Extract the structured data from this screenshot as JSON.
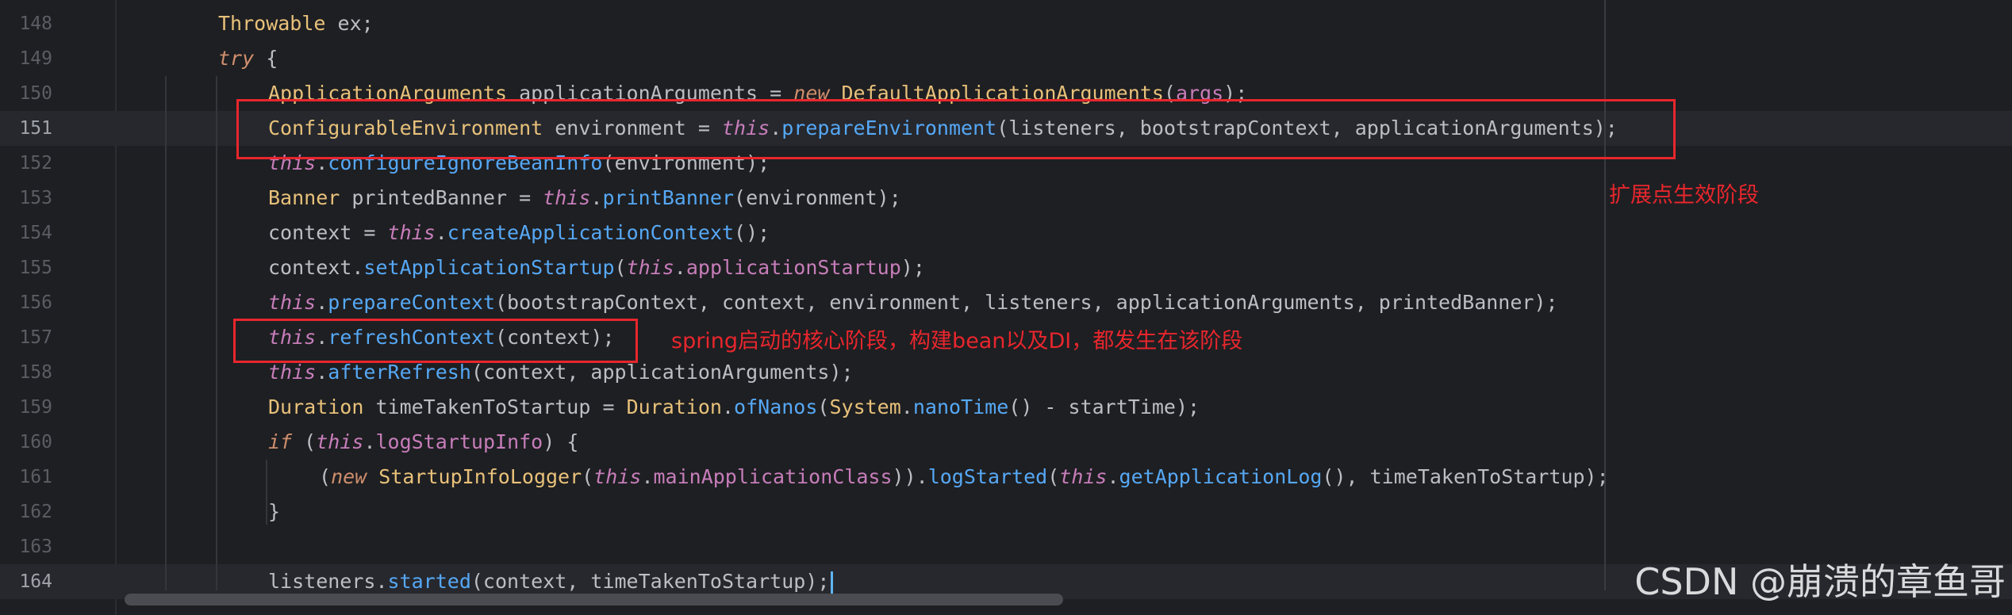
{
  "editor": {
    "lines": [
      {
        "no": "148",
        "tokens": [
          {
            "t": "Throwable",
            "c": "ty"
          },
          {
            "t": " ex;",
            "c": ""
          }
        ]
      },
      {
        "no": "149",
        "tokens": [
          {
            "t": "try",
            "c": "kw"
          },
          {
            "t": " {",
            "c": ""
          }
        ]
      },
      {
        "no": "150",
        "tokens": [
          {
            "t": "ApplicationArguments",
            "c": "ty"
          },
          {
            "t": " applicationArguments = ",
            "c": ""
          },
          {
            "t": "new",
            "c": "kw"
          },
          {
            "t": " ",
            "c": ""
          },
          {
            "t": "DefaultApplicationArguments",
            "c": "ty"
          },
          {
            "t": "(",
            "c": ""
          },
          {
            "t": "args",
            "c": "fd"
          },
          {
            "t": ");",
            "c": ""
          }
        ]
      },
      {
        "no": "151",
        "tokens": [
          {
            "t": "ConfigurableEnvironment",
            "c": "ty"
          },
          {
            "t": " environment = ",
            "c": ""
          },
          {
            "t": "this",
            "c": "th"
          },
          {
            "t": ".",
            "c": ""
          },
          {
            "t": "prepareEnvironment",
            "c": "fn"
          },
          {
            "t": "(listeners, bootstrapContext, applicationArguments);",
            "c": ""
          }
        ]
      },
      {
        "no": "152",
        "tokens": [
          {
            "t": "this",
            "c": "th"
          },
          {
            "t": ".",
            "c": ""
          },
          {
            "t": "configureIgnoreBeanInfo",
            "c": "fn"
          },
          {
            "t": "(environment);",
            "c": ""
          }
        ]
      },
      {
        "no": "153",
        "tokens": [
          {
            "t": "Banner",
            "c": "ty"
          },
          {
            "t": " printedBanner = ",
            "c": ""
          },
          {
            "t": "this",
            "c": "th"
          },
          {
            "t": ".",
            "c": ""
          },
          {
            "t": "printBanner",
            "c": "fn"
          },
          {
            "t": "(environment);",
            "c": ""
          }
        ]
      },
      {
        "no": "154",
        "tokens": [
          {
            "t": "context = ",
            "c": ""
          },
          {
            "t": "this",
            "c": "th"
          },
          {
            "t": ".",
            "c": ""
          },
          {
            "t": "createApplicationContext",
            "c": "fn"
          },
          {
            "t": "();",
            "c": ""
          }
        ]
      },
      {
        "no": "155",
        "tokens": [
          {
            "t": "context.",
            "c": ""
          },
          {
            "t": "setApplicationStartup",
            "c": "fn"
          },
          {
            "t": "(",
            "c": ""
          },
          {
            "t": "this",
            "c": "th"
          },
          {
            "t": ".",
            "c": ""
          },
          {
            "t": "applicationStartup",
            "c": "fd"
          },
          {
            "t": ");",
            "c": ""
          }
        ]
      },
      {
        "no": "156",
        "tokens": [
          {
            "t": "this",
            "c": "th"
          },
          {
            "t": ".",
            "c": ""
          },
          {
            "t": "prepareContext",
            "c": "fn"
          },
          {
            "t": "(bootstrapContext, context, environment, listeners, applicationArguments, printedBanner);",
            "c": ""
          }
        ]
      },
      {
        "no": "157",
        "tokens": [
          {
            "t": "this",
            "c": "th"
          },
          {
            "t": ".",
            "c": ""
          },
          {
            "t": "refreshContext",
            "c": "fn"
          },
          {
            "t": "(context);",
            "c": ""
          }
        ]
      },
      {
        "no": "158",
        "tokens": [
          {
            "t": "this",
            "c": "th"
          },
          {
            "t": ".",
            "c": ""
          },
          {
            "t": "afterRefresh",
            "c": "fn"
          },
          {
            "t": "(context, applicationArguments);",
            "c": ""
          }
        ]
      },
      {
        "no": "159",
        "tokens": [
          {
            "t": "Duration",
            "c": "ty"
          },
          {
            "t": " timeTakenToStartup = ",
            "c": ""
          },
          {
            "t": "Duration",
            "c": "ty"
          },
          {
            "t": ".",
            "c": ""
          },
          {
            "t": "ofNanos",
            "c": "fn"
          },
          {
            "t": "(",
            "c": ""
          },
          {
            "t": "System",
            "c": "ty"
          },
          {
            "t": ".",
            "c": ""
          },
          {
            "t": "nanoTime",
            "c": "fn"
          },
          {
            "t": "() - startTime);",
            "c": ""
          }
        ]
      },
      {
        "no": "160",
        "tokens": [
          {
            "t": "if",
            "c": "kw"
          },
          {
            "t": " (",
            "c": ""
          },
          {
            "t": "this",
            "c": "th"
          },
          {
            "t": ".",
            "c": ""
          },
          {
            "t": "logStartupInfo",
            "c": "fd"
          },
          {
            "t": ") {",
            "c": ""
          }
        ]
      },
      {
        "no": "161",
        "tokens": [
          {
            "t": "(",
            "c": ""
          },
          {
            "t": "new",
            "c": "kw"
          },
          {
            "t": " ",
            "c": ""
          },
          {
            "t": "StartupInfoLogger",
            "c": "ty"
          },
          {
            "t": "(",
            "c": ""
          },
          {
            "t": "this",
            "c": "th"
          },
          {
            "t": ".",
            "c": ""
          },
          {
            "t": "mainApplicationClass",
            "c": "fd"
          },
          {
            "t": ")).",
            "c": ""
          },
          {
            "t": "logStarted",
            "c": "fn"
          },
          {
            "t": "(",
            "c": ""
          },
          {
            "t": "this",
            "c": "th"
          },
          {
            "t": ".",
            "c": ""
          },
          {
            "t": "getApplicationLog",
            "c": "fn"
          },
          {
            "t": "(), timeTakenToStartup);",
            "c": ""
          }
        ]
      },
      {
        "no": "162",
        "tokens": [
          {
            "t": "}",
            "c": ""
          }
        ]
      },
      {
        "no": "163",
        "tokens": []
      },
      {
        "no": "164",
        "tokens": [
          {
            "t": "listeners.",
            "c": ""
          },
          {
            "t": "started",
            "c": "fn"
          },
          {
            "t": "(context, timeTakenToStartup);",
            "c": ""
          }
        ]
      }
    ]
  },
  "annotations": {
    "extension_note": "扩展点生效阶段",
    "refresh_note": "spring启动的核心阶段，构建bean以及DI，都发生在该阶段"
  },
  "watermark": "CSDN @崩溃的章鱼哥",
  "colors": {
    "background": "#1e1f22",
    "keyword": "#cf8e6d",
    "type": "#e8c17a",
    "method": "#56a8f5",
    "this_field": "#c77dba",
    "annotation_red": "#e8262d"
  }
}
